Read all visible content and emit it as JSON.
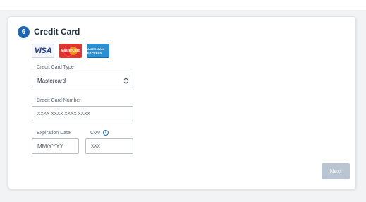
{
  "section": {
    "step_number": "6",
    "title": "Credit Card"
  },
  "card_logos": [
    {
      "name": "visa",
      "text": "VISA"
    },
    {
      "name": "mastercard",
      "text": "MasterCard"
    },
    {
      "name": "american-express",
      "text": "AMERICAN EXPRESS"
    }
  ],
  "form": {
    "card_type": {
      "label": "Credit Card Type",
      "value": "Mastercard"
    },
    "card_number": {
      "label": "Credit Card Number",
      "placeholder": "XXXX XXXX XXXX XXXX"
    },
    "expiration": {
      "label": "Expiration Date",
      "placeholder": "MM/YYYY"
    },
    "cvv": {
      "label": "CVV",
      "placeholder": "XXX",
      "info_icon": "i"
    }
  },
  "actions": {
    "next_label": "Next"
  },
  "colors": {
    "accent": "#1f67b1",
    "next_disabled": "#b9c6d1"
  }
}
